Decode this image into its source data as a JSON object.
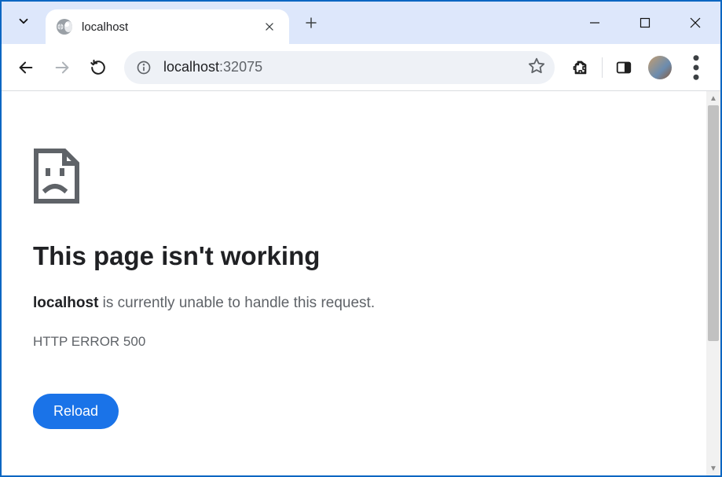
{
  "tab": {
    "title": "localhost"
  },
  "address": {
    "host": "localhost",
    "port": ":32075"
  },
  "error_page": {
    "heading": "This page isn't working",
    "host": "localhost",
    "message_rest": " is currently unable to handle this request.",
    "error_code": "HTTP ERROR 500",
    "reload_label": "Reload"
  }
}
